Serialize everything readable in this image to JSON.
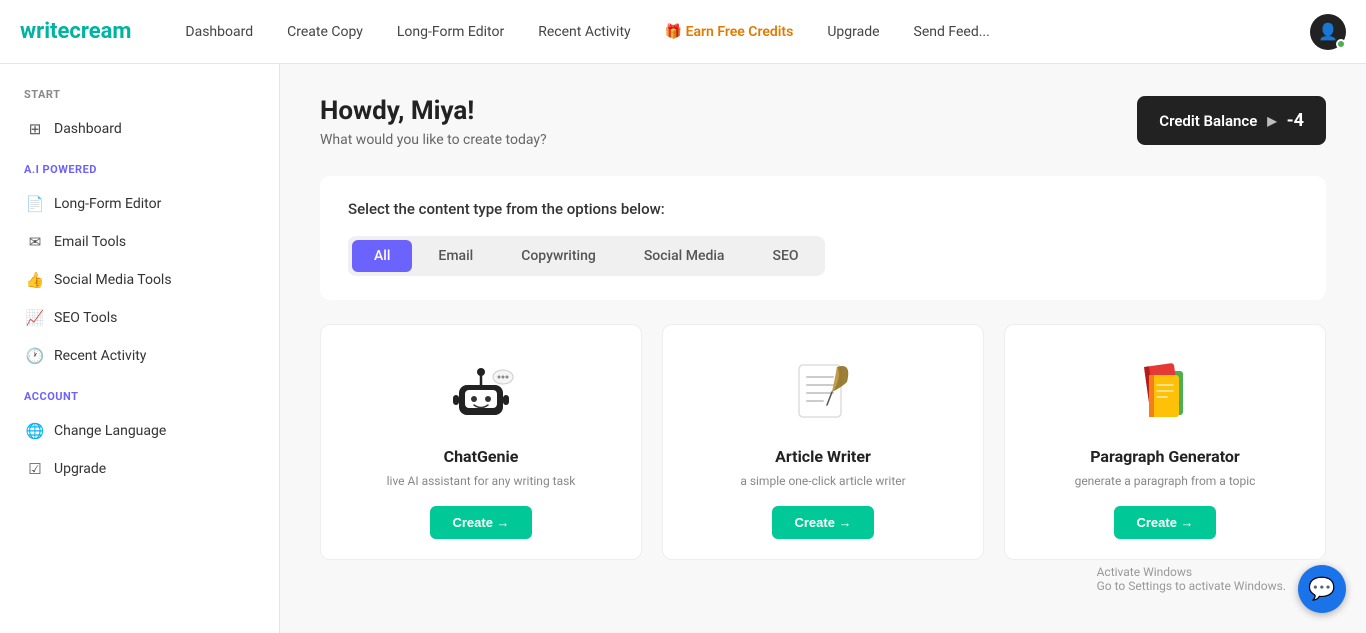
{
  "brand": {
    "name_black": "write",
    "name_teal": "cream"
  },
  "topnav": {
    "links": [
      {
        "id": "dashboard",
        "label": "Dashboard",
        "active": false,
        "earn": false
      },
      {
        "id": "create-copy",
        "label": "Create Copy",
        "active": false,
        "earn": false
      },
      {
        "id": "long-form-editor",
        "label": "Long-Form Editor",
        "active": false,
        "earn": false
      },
      {
        "id": "recent-activity",
        "label": "Recent Activity",
        "active": false,
        "earn": false
      },
      {
        "id": "earn-free-credits",
        "label": "Earn Free Credits",
        "active": false,
        "earn": true
      },
      {
        "id": "upgrade",
        "label": "Upgrade",
        "active": false,
        "earn": false
      },
      {
        "id": "send-feedback",
        "label": "Send Feed...",
        "active": false,
        "earn": false
      }
    ]
  },
  "sidebar": {
    "start_label": "Start",
    "ai_label": "A.I Powered",
    "account_label": "Account",
    "items_start": [
      {
        "id": "dashboard",
        "label": "Dashboard",
        "icon": "⊞"
      }
    ],
    "items_ai": [
      {
        "id": "long-form-editor",
        "label": "Long-Form Editor",
        "icon": "📄"
      },
      {
        "id": "email-tools",
        "label": "Email Tools",
        "icon": "✉"
      },
      {
        "id": "social-media-tools",
        "label": "Social Media Tools",
        "icon": "👍"
      },
      {
        "id": "seo-tools",
        "label": "SEO Tools",
        "icon": "📈"
      },
      {
        "id": "recent-activity",
        "label": "Recent Activity",
        "icon": "🕐"
      }
    ],
    "items_account": [
      {
        "id": "change-language",
        "label": "Change Language",
        "icon": "🌐"
      },
      {
        "id": "upgrade",
        "label": "Upgrade",
        "icon": "☑"
      }
    ]
  },
  "main": {
    "greeting": "Howdy, Miya!",
    "subtitle": "What would you like to create today?",
    "credit_balance_label": "Credit Balance",
    "credit_balance_value": "-4",
    "content_type_label": "Select the content type from the options below:",
    "filter_tabs": [
      {
        "id": "all",
        "label": "All",
        "active": true
      },
      {
        "id": "email",
        "label": "Email",
        "active": false
      },
      {
        "id": "copywriting",
        "label": "Copywriting",
        "active": false
      },
      {
        "id": "social-media",
        "label": "Social Media",
        "active": false
      },
      {
        "id": "seo",
        "label": "SEO",
        "active": false
      }
    ],
    "tools": [
      {
        "id": "chatgenie",
        "name": "ChatGenie",
        "desc": "live AI assistant for any writing task",
        "icon": "🤖",
        "create_label": "Create →"
      },
      {
        "id": "article-writer",
        "name": "Article Writer",
        "desc": "a simple one-click article writer",
        "icon": "📝",
        "create_label": "Create →"
      },
      {
        "id": "paragraph-generator",
        "name": "Paragraph Generator",
        "desc": "generate a paragraph from a topic",
        "icon": "📚",
        "create_label": "Create →"
      }
    ]
  },
  "watermark": {
    "line1": "Activate Windows",
    "line2": "Go to Settings to activate Windows."
  }
}
